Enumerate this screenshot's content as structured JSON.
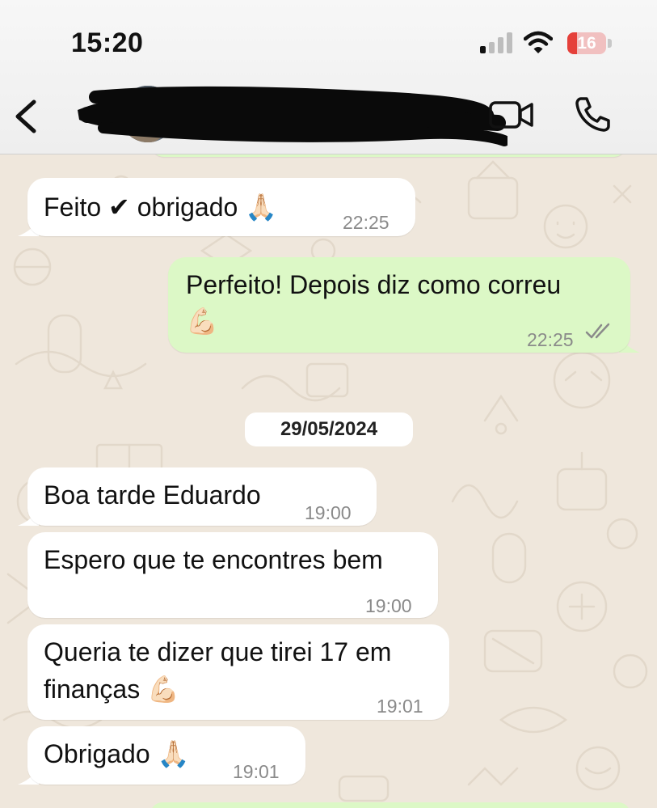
{
  "status_bar": {
    "time": "15:20",
    "battery": "16",
    "battery_level": 0.16
  },
  "header": {
    "contact_name": ""
  },
  "messages": [
    {
      "direction": "incoming",
      "text": "Feito ✔ obrigado 🙏🏻",
      "time": "22:25"
    },
    {
      "direction": "outgoing",
      "text_line1": "Perfeito! Depois diz como correu",
      "text_line2": "💪🏻",
      "time": "22:25",
      "read": true
    },
    {
      "direction": "incoming",
      "text": "Boa tarde Eduardo",
      "time": "19:00"
    },
    {
      "direction": "incoming",
      "text": "Espero que te encontres bem",
      "time": "19:00"
    },
    {
      "direction": "incoming",
      "text_line1": "Queria te dizer que tirei 17 em",
      "text_line2": "finanças 💪🏻",
      "time": "19:01"
    },
    {
      "direction": "incoming",
      "text": "Obrigado 🙏🏻",
      "time": "19:01"
    }
  ],
  "date_separator": "29/05/2024",
  "icons": {
    "back": "chevron-left-icon",
    "video": "video-camera-icon",
    "phone": "phone-icon",
    "signal": "cellular-signal-icon",
    "wifi": "wifi-icon",
    "battery": "battery-icon",
    "read_receipt": "double-check-icon"
  },
  "colors": {
    "chat_background": "#efe7dc",
    "incoming_bubble": "#ffffff",
    "outgoing_bubble": "#dcf8c6",
    "timestamp": "#8a8a8a",
    "battery_low": "#e5403a"
  }
}
